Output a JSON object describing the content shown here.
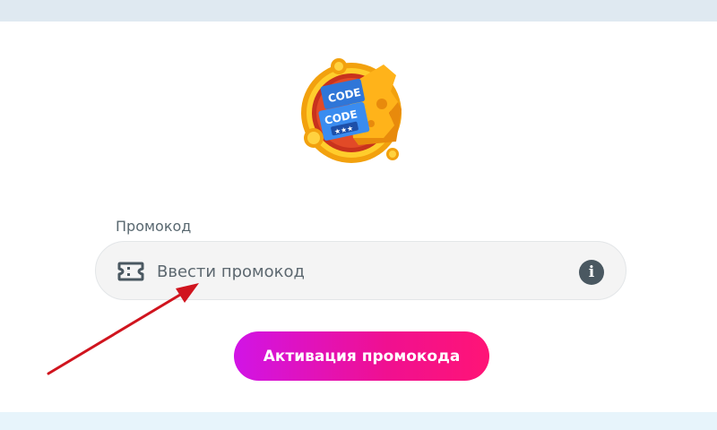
{
  "promo": {
    "label": "Промокод",
    "placeholder": "Ввести промокод",
    "value": ""
  },
  "buttons": {
    "activate": "Активация промокода"
  },
  "logo": {
    "code_text_top": "CODE",
    "code_text_bottom": "CODE",
    "stars": "★★★"
  },
  "icons": {
    "ticket": "ticket-icon",
    "info": "info-icon",
    "info_glyph": "i"
  },
  "colors": {
    "accent_start": "#d114e6",
    "accent_end": "#ff1476",
    "annotation_arrow": "#d0141e"
  }
}
